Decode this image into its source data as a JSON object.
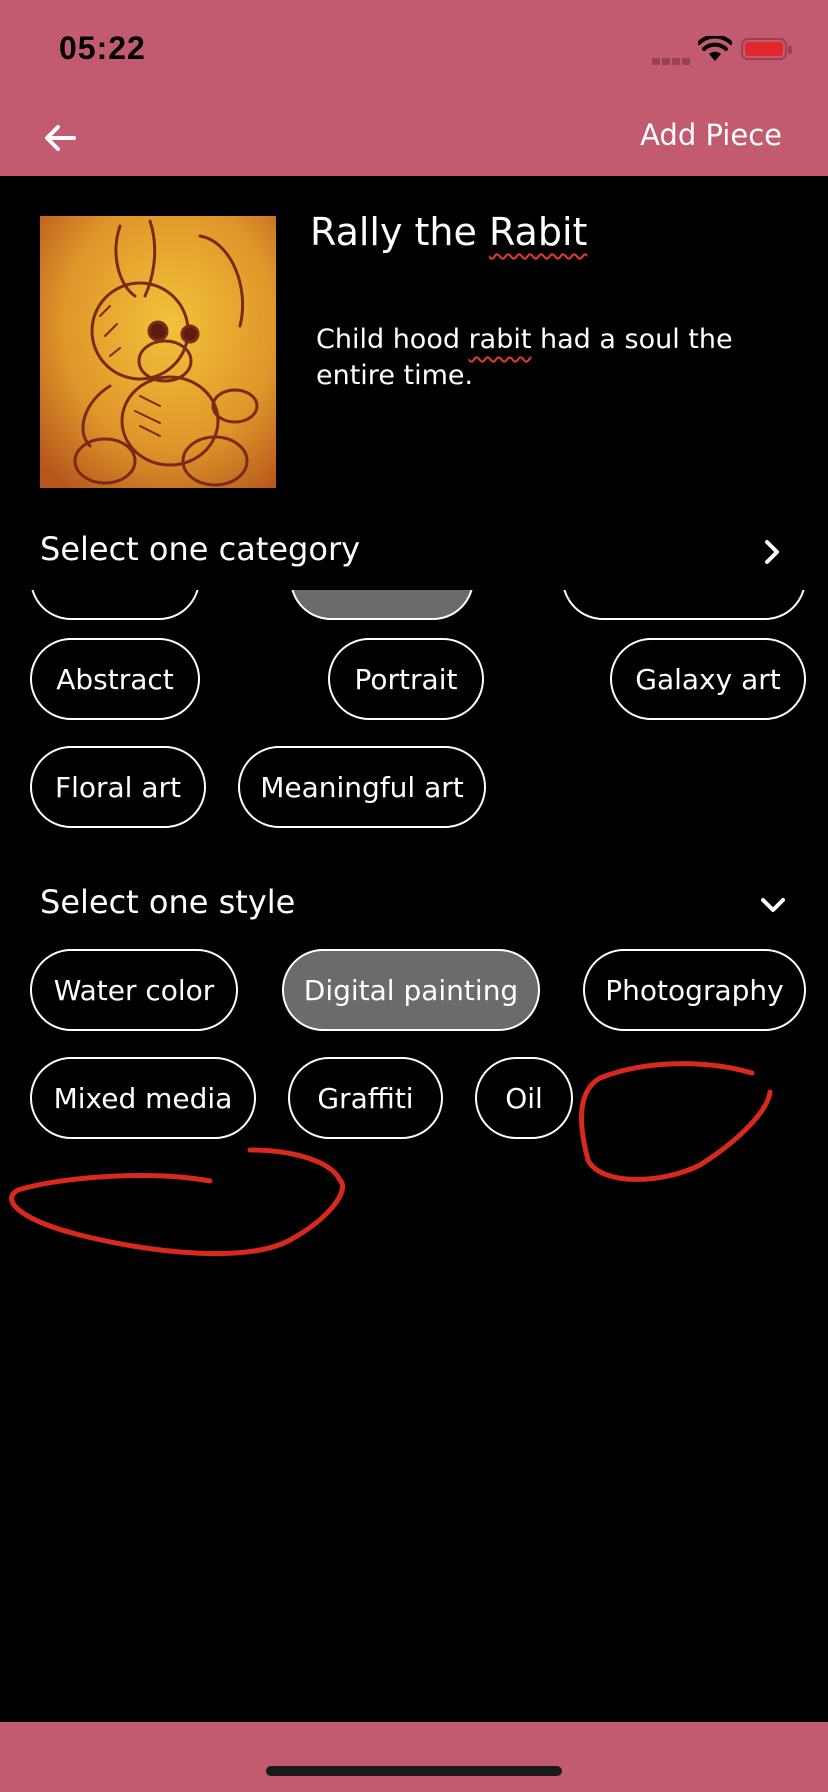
{
  "status": {
    "time": "05:22"
  },
  "nav": {
    "title": "Add Piece"
  },
  "piece": {
    "title_part1": "Rally the ",
    "title_part2": "Rabit",
    "desc_part1": "Child hood ",
    "desc_part2": "rabit",
    "desc_part3": " had a soul the entire time."
  },
  "category": {
    "heading": "Select one category",
    "chips": [
      "Abstract",
      "Portrait",
      "Galaxy art",
      "Floral art",
      "Meaningful art"
    ]
  },
  "style": {
    "heading": "Select one style",
    "chips": [
      "Water color",
      "Digital painting",
      "Photography",
      "Mixed media",
      "Graffiti",
      "Oil"
    ],
    "selected": "Digital painting"
  },
  "colors": {
    "accent": "#c25b6f",
    "selected_chip": "#6b6a6c",
    "annotation": "#d9291c"
  }
}
